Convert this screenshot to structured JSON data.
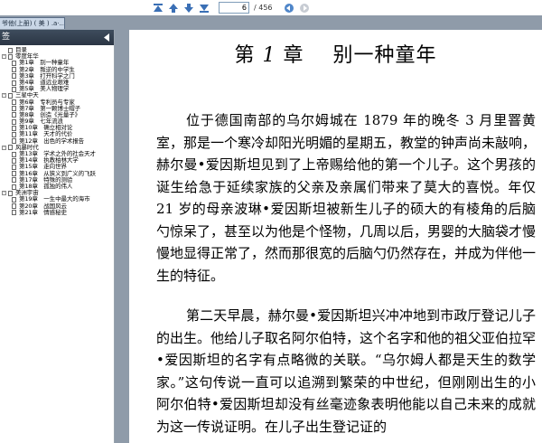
{
  "toolbar": {
    "page_current": "6",
    "page_total": "/ 456"
  },
  "document_tab": {
    "label": "爷他(上册) ( 美 ) .a·..."
  },
  "bookmarks": {
    "header": "签",
    "items": [
      {
        "type": "top",
        "label": "目录",
        "expander": ""
      },
      {
        "type": "top",
        "label": "零度年华",
        "expander": "-"
      },
      {
        "type": "chap",
        "label": "第1章　别一种童年"
      },
      {
        "type": "chap",
        "label": "第2章　叛逆的中学生"
      },
      {
        "type": "chap",
        "label": "第3章　打开科学之门"
      },
      {
        "type": "chap",
        "label": "第4章　道远业艰难"
      },
      {
        "type": "chap",
        "label": "第5章　美人物理学"
      },
      {
        "type": "top",
        "label": "三星中天",
        "expander": "-"
      },
      {
        "type": "chap",
        "label": "第6章　专利员与专家"
      },
      {
        "type": "chap",
        "label": "第7章　第一颗博士帽子"
      },
      {
        "type": "chap",
        "label": "第8章　创造《光量子》"
      },
      {
        "type": "chap",
        "label": "第9章　七年流浪"
      },
      {
        "type": "chap",
        "label": "第10章　确立相对论"
      },
      {
        "type": "chap",
        "label": "第11章　天才的代价"
      },
      {
        "type": "chap",
        "label": "第12章　出色的学术报告"
      },
      {
        "type": "top",
        "label": "风暴时代",
        "expander": "-"
      },
      {
        "type": "chap",
        "label": "第13章　学术之外的社会天才"
      },
      {
        "type": "chap",
        "label": "第14章　执教柏林大学"
      },
      {
        "type": "chap",
        "label": "第15章　走向世界"
      },
      {
        "type": "chap",
        "label": "第16章　从狭义到广义的飞跃"
      },
      {
        "type": "chap",
        "label": "第17章　特殊的测验"
      },
      {
        "type": "chap",
        "label": "第18章　孤独的伟人"
      },
      {
        "type": "top",
        "label": "美洲宇宙",
        "expander": "-"
      },
      {
        "type": "chap",
        "label": "第19章　一生中最大的海市"
      },
      {
        "type": "chap",
        "label": "第20章　战国风云"
      },
      {
        "type": "chap",
        "label": "第21章　情感秘史"
      }
    ]
  },
  "content": {
    "chapter_prefix": "第",
    "chapter_num": "1",
    "chapter_suffix": "章",
    "chapter_title": "别一种童年",
    "paragraphs": [
      "位于德国南部的乌尔姆城在 1879 年的晚冬 3 月里罯黄室，那是一个寒冷却阳光明媚的星期五，教堂的钟声尚未敲响，赫尔曼•爱因斯坦见到了上帝赐给他的第一个儿子。这个男孩的诞生给急于延续家族的父亲及亲属们带来了莫大的喜悦。年仅 21 岁的母亲波琳•爱因斯坦被新生儿子的硕大的有棱角的后脑勺惊呆了，甚至以为他是个怪物，几周以后，男婴的大脑袋才慢慢地显得正常了，然而那很宽的后脑勺仍然存在，并成为伴他一生的特征。",
      "第二天早晨，赫尔曼•爱因斯坦兴冲冲地到市政厅登记儿子的出生。他给儿子取名阿尔伯特，这个名字和他的祖父亚伯拉罕•爱因斯坦的名字有点略微的关联。“乌尔姆人都是天生的数学家。”这句传说一直可以追溯到繁荣的中世纪，但刚刚出生的小阿尔伯特•爱因斯坦却没有丝毫迹象表明他能以自己未来的成就为这一传说证明。在儿子出生登记证的"
    ]
  }
}
